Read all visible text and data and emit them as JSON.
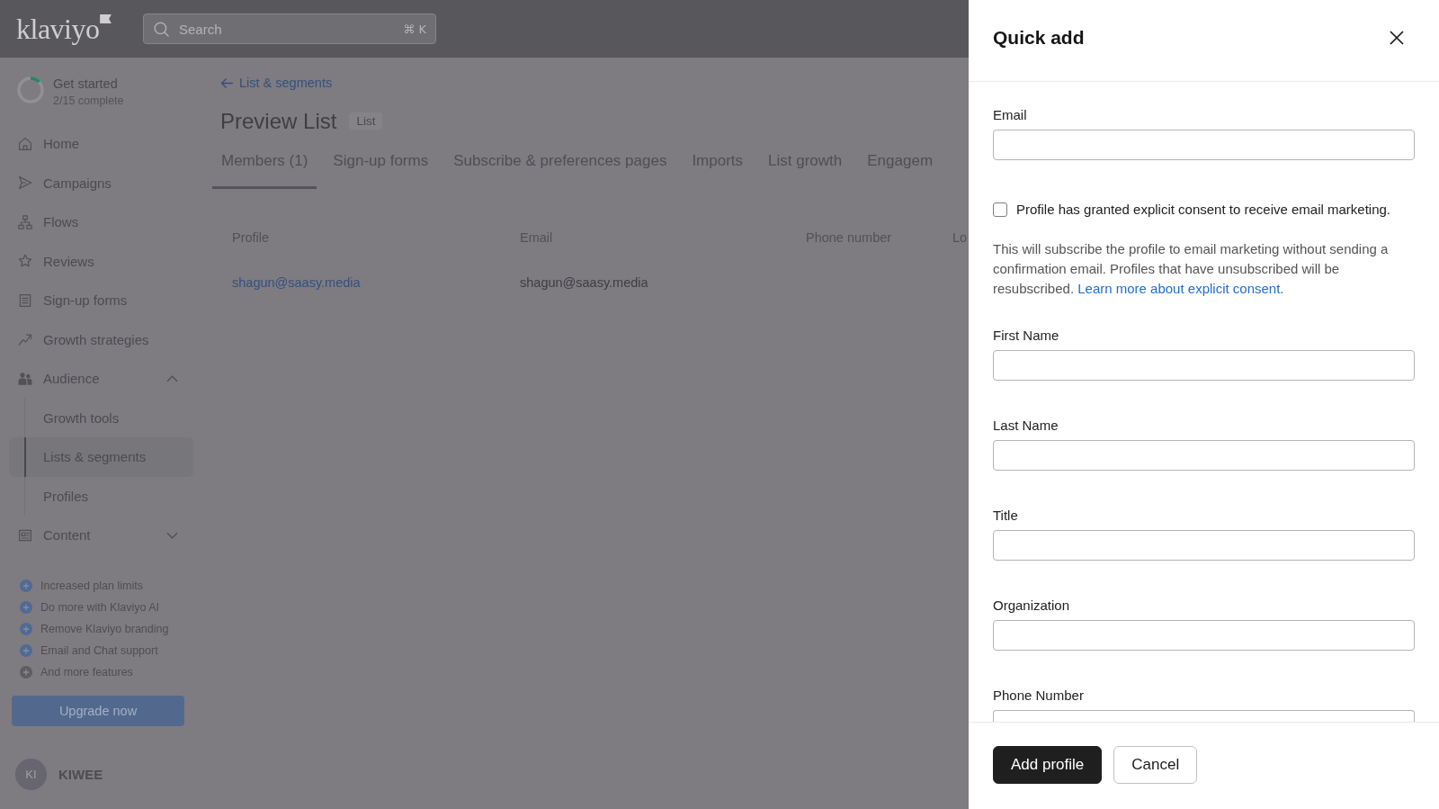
{
  "header": {
    "logo": "klaviyo",
    "search": {
      "placeholder": "Search",
      "shortcut": "⌘ K"
    }
  },
  "sidebar": {
    "onboarding": {
      "title": "Get started",
      "progress": "2/15 complete",
      "level": 0.13
    },
    "items": [
      {
        "label": "Home",
        "kind": "link",
        "selected": false
      },
      {
        "label": "Campaigns",
        "kind": "link",
        "selected": false
      },
      {
        "label": "Flows",
        "kind": "link",
        "selected": false
      },
      {
        "label": "Reviews",
        "kind": "link",
        "selected": false
      },
      {
        "label": "Sign-up forms",
        "kind": "link",
        "selected": false
      },
      {
        "label": "Growth strategies",
        "kind": "link",
        "selected": false
      },
      {
        "label": "Audience",
        "kind": "group",
        "selected": false,
        "expanded": true,
        "children": [
          {
            "label": "Growth tools",
            "selected": false
          },
          {
            "label": "Lists & segments",
            "selected": true
          },
          {
            "label": "Profiles",
            "selected": false
          }
        ]
      },
      {
        "label": "Content",
        "kind": "group",
        "selected": false,
        "expanded": false
      }
    ],
    "features": [
      {
        "label": "Increased plan limits",
        "color": "#4f6a96"
      },
      {
        "label": "Do more with Klaviyo AI",
        "color": "#4f6a96"
      },
      {
        "label": "Remove Klaviyo branding",
        "color": "#4f6a96"
      },
      {
        "label": "Email and Chat support",
        "color": "#4f6a96"
      },
      {
        "label": "And more features",
        "color": "#5e5d62"
      }
    ],
    "upgrade_button": "Upgrade now",
    "account": {
      "initials": "KI",
      "name": "KIWEE"
    }
  },
  "page": {
    "back_link": "List & segments",
    "title": "Preview List",
    "badge": "List",
    "tabs": [
      {
        "label": "Members (1)",
        "selected": true
      },
      {
        "label": "Sign-up forms",
        "selected": false
      },
      {
        "label": "Subscribe & preferences pages",
        "selected": false
      },
      {
        "label": "Imports",
        "selected": false
      },
      {
        "label": "List growth",
        "selected": false
      },
      {
        "label": "Engagem",
        "selected": false
      }
    ],
    "table": {
      "columns": [
        "Profile",
        "Email",
        "Phone number",
        "Lo"
      ],
      "rows": [
        {
          "cells": [
            "shagun@saasy.media",
            "shagun@saasy.media"
          ]
        }
      ]
    }
  },
  "panel": {
    "title": "Quick add",
    "email": {
      "label": "Email"
    },
    "consent": {
      "label": "Profile has granted explicit consent to receive email marketing.",
      "checked": false
    },
    "consent_note": {
      "text": "This will subscribe the profile to email marketing without sending a confirmation email. Profiles that have unsubscribed will be resubscribed.",
      "link": "Learn more about explicit consent."
    },
    "fields": [
      {
        "label": "First Name"
      },
      {
        "label": "Last Name"
      },
      {
        "label": "Title"
      },
      {
        "label": "Organization"
      },
      {
        "label": "Phone Number"
      }
    ],
    "buttons": [
      {
        "label": "Add profile",
        "kind": "primary"
      },
      {
        "label": "Cancel",
        "kind": "secondary"
      }
    ]
  }
}
